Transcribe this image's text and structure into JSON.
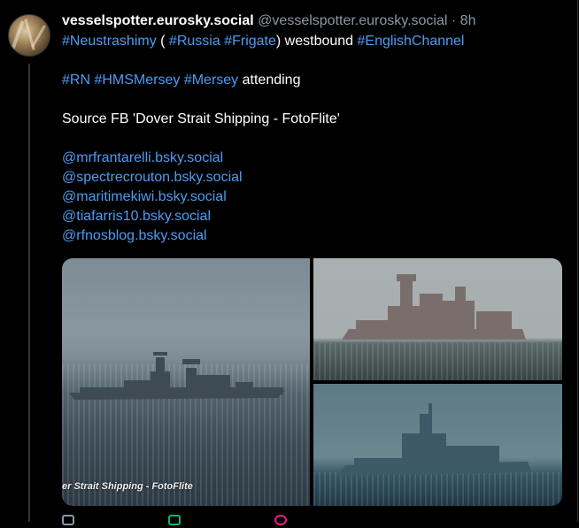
{
  "post": {
    "display_name": "vesselspotter.eurosky.social",
    "handle": "@vesselspotter.eurosky.social",
    "separator": "·",
    "time": "8h",
    "line1": {
      "tag1": "#Neustrashimy",
      "paren_open": " ( ",
      "tag2": "#Russia",
      "tag3": "#Frigate",
      "paren_close": ") westbound ",
      "tag4": "#EnglishChannel"
    },
    "line2": {
      "tag1": "#RN",
      "tag2": "#HMSMersey",
      "tag3": "#Mersey",
      "suffix": " attending"
    },
    "source": "Source FB 'Dover Strait Shipping - FotoFlite'",
    "mentions": [
      "@mrfrantarelli.bsky.social",
      "@spectrecrouton.bsky.social",
      "@maritimekiwi.bsky.social",
      "@tiafarris10.bsky.social",
      "@rfnosblog.bsky.social"
    ],
    "image_caption": "er Strait Shipping - FotoFlite"
  },
  "icons": {
    "avatar": "avatar-photo",
    "reply": "reply-icon",
    "repost": "repost-icon",
    "like": "like-icon"
  },
  "colors": {
    "background": "#000000",
    "link": "#4c9df3",
    "muted": "#8b98a5",
    "like": "#f91880",
    "repost": "#00ba7c"
  }
}
